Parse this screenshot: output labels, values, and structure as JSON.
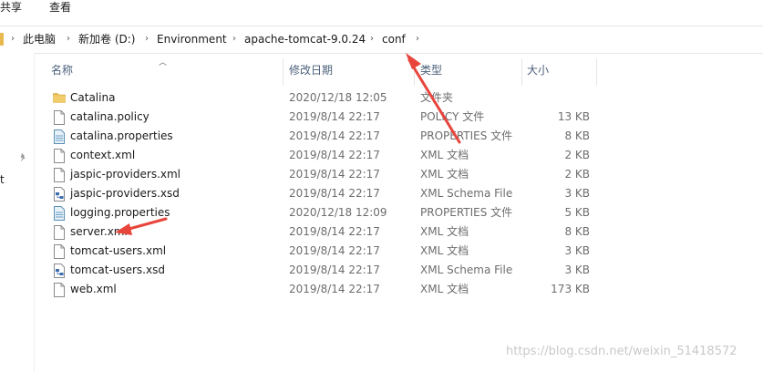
{
  "ribbon": {
    "tabs": [
      "共享",
      "查看"
    ]
  },
  "address_bar": {
    "breadcrumbs": [
      "此电脑",
      "新加卷 (D:)",
      "Environment",
      "apache-tomcat-9.0.24",
      "conf"
    ]
  },
  "nav_pane": {
    "fragment": "t"
  },
  "file_list": {
    "columns": {
      "name": "名称",
      "date": "修改日期",
      "type": "类型",
      "size": "大小"
    },
    "files": [
      {
        "name": "Catalina",
        "date": "2020/12/18 12:05",
        "type": "文件夹",
        "size": "",
        "icon": "folder-icon"
      },
      {
        "name": "catalina.policy",
        "date": "2019/8/14 22:17",
        "type": "POLICY 文件",
        "size": "13 KB",
        "icon": "file-icon"
      },
      {
        "name": "catalina.properties",
        "date": "2019/8/14 22:17",
        "type": "PROPERTIES 文件",
        "size": "8 KB",
        "icon": "properties-file-icon"
      },
      {
        "name": "context.xml",
        "date": "2019/8/14 22:17",
        "type": "XML 文档",
        "size": "2 KB",
        "icon": "file-icon"
      },
      {
        "name": "jaspic-providers.xml",
        "date": "2019/8/14 22:17",
        "type": "XML 文档",
        "size": "2 KB",
        "icon": "file-icon"
      },
      {
        "name": "jaspic-providers.xsd",
        "date": "2019/8/14 22:17",
        "type": "XML Schema File",
        "size": "3 KB",
        "icon": "xsd-file-icon"
      },
      {
        "name": "logging.properties",
        "date": "2020/12/18 12:09",
        "type": "PROPERTIES 文件",
        "size": "5 KB",
        "icon": "properties-file-icon"
      },
      {
        "name": "server.xml",
        "date": "2019/8/14 22:17",
        "type": "XML 文档",
        "size": "8 KB",
        "icon": "file-icon"
      },
      {
        "name": "tomcat-users.xml",
        "date": "2019/8/14 22:17",
        "type": "XML 文档",
        "size": "3 KB",
        "icon": "file-icon"
      },
      {
        "name": "tomcat-users.xsd",
        "date": "2019/8/14 22:17",
        "type": "XML Schema File",
        "size": "3 KB",
        "icon": "xsd-file-icon"
      },
      {
        "name": "web.xml",
        "date": "2019/8/14 22:17",
        "type": "XML 文档",
        "size": "173 KB",
        "icon": "file-icon"
      }
    ]
  },
  "watermark": "https://blog.csdn.net/weixin_51418572",
  "colors": {
    "annotation_arrow": "#e8453c",
    "folder": "#e7b94f",
    "header_text": "#4c607a"
  }
}
